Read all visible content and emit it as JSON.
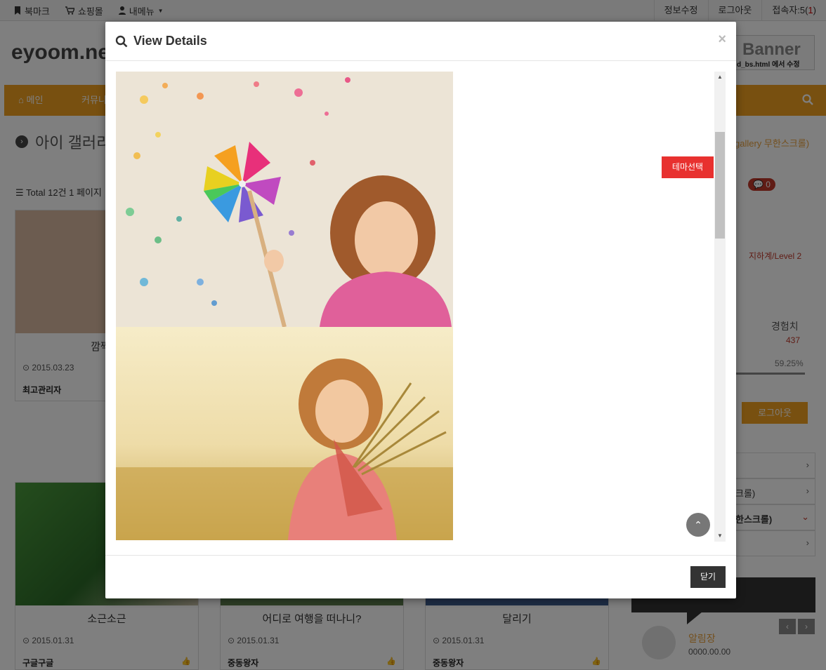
{
  "topbar": {
    "bookmark": "북마크",
    "shop": "쇼핑몰",
    "mymenu": "내메뉴",
    "edit_info": "정보수정",
    "logout": "로그아웃",
    "visitors_label": "접속자:5(",
    "visitors_count": "1",
    "visitors_close": ")"
  },
  "site": {
    "logo": "eyoom.ne",
    "banner_title": "Banner",
    "banner_sub": "d_bs.html 에서 수정"
  },
  "nav": {
    "home": "메인",
    "community": "커뮤니"
  },
  "page": {
    "title": "아이 갤러리",
    "breadcrumb_right": "gallery 무한스크롤)",
    "total": "Total 12건 1 페이지"
  },
  "cards": [
    {
      "title": "깜짝 놀",
      "date": "2015.03.23",
      "author": "최고관리자"
    },
    {
      "title": "소근소근",
      "date": "2015.01.31",
      "author": "구글구글"
    },
    {
      "title": "어디로 여행을 떠나니?",
      "date": "2015.01.31",
      "author": "중동왕자"
    },
    {
      "title": "달리기",
      "date": "2015.01.31",
      "author": "중동왕자"
    }
  ],
  "sidebar": {
    "badge": "0",
    "level": "지하계/Level 2",
    "xp_label": "경험치",
    "xp_value": "437",
    "xp_percent": "59.25%",
    "xp_fraction": 0.5925,
    "logout": "로그아웃",
    "menu_items": [
      "",
      "크롤)",
      "한스크롤)",
      ""
    ],
    "notice_name": "알림장",
    "notice_date": "0000.00.00"
  },
  "modal": {
    "title": "View Details",
    "close_x": "×",
    "theme_select": "테마선택",
    "close_button": "닫기"
  },
  "colors": {
    "accent": "#f0a020",
    "theme_button": "#e8312f",
    "modal_footer_button": "#333333"
  }
}
